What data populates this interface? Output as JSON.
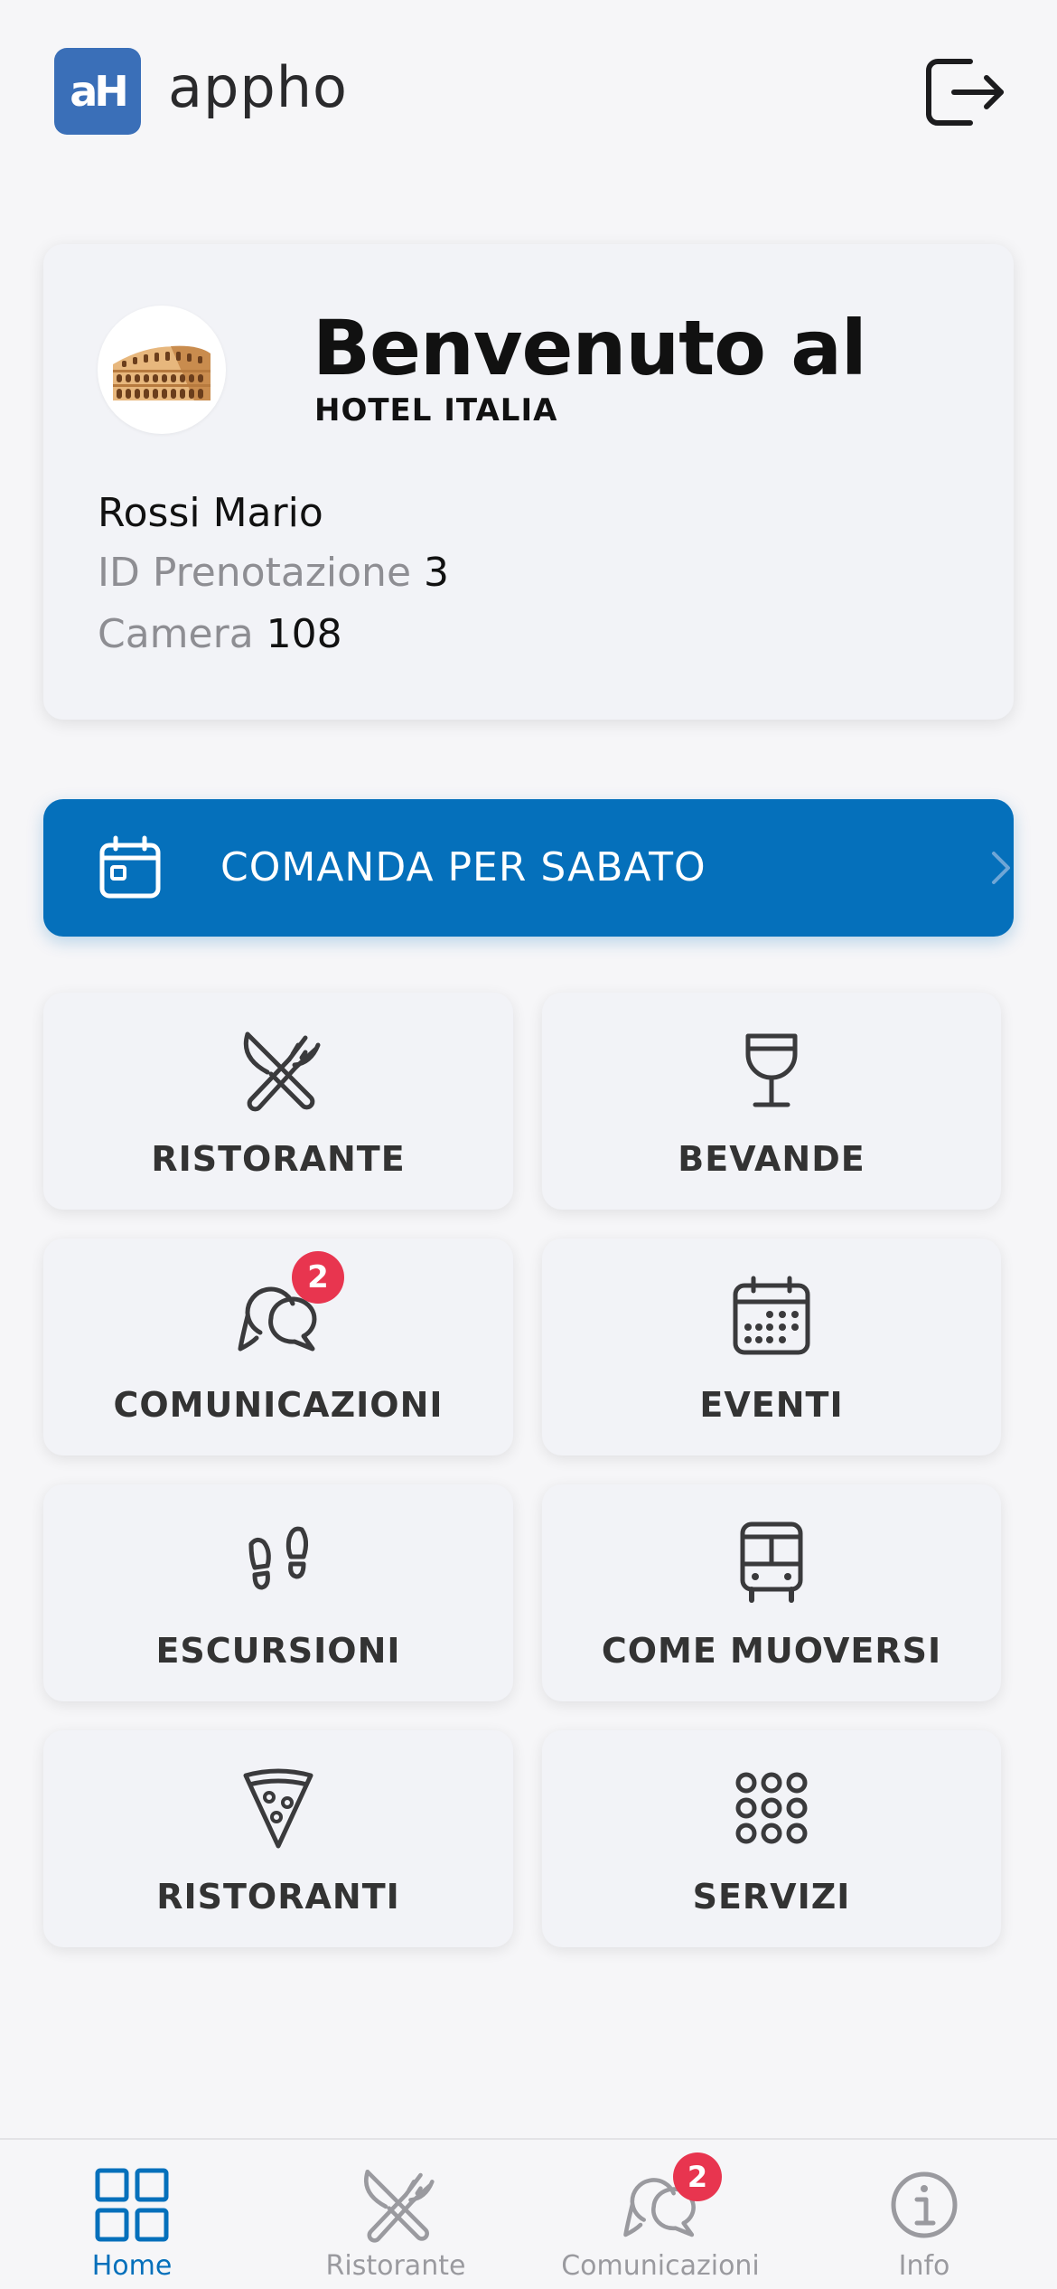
{
  "header": {
    "logo_text": "aH",
    "brand": "appho",
    "logout_icon": "logout-icon"
  },
  "welcome": {
    "title": "Benvenuto al",
    "hotel_name": "HOTEL ITALIA",
    "guest_name": "Rossi Mario",
    "booking_label": "ID Prenotazione",
    "booking_id": "3",
    "room_label": "Camera",
    "room_number": "108",
    "avatar_icon": "colosseum-icon"
  },
  "order_banner": {
    "label": "COMANDA PER SABATO",
    "icon": "calendar-icon",
    "chevron": "chevron-right-icon",
    "color": "#0570bb"
  },
  "tiles": [
    {
      "label": "RISTORANTE",
      "icon": "fork-knife-icon"
    },
    {
      "label": "BEVANDE",
      "icon": "wine-glass-icon"
    },
    {
      "label": "COMUNICAZIONI",
      "icon": "chat-bubbles-icon",
      "badge": "2"
    },
    {
      "label": "EVENTI",
      "icon": "calendar-grid-icon"
    },
    {
      "label": "ESCURSIONI",
      "icon": "footprints-icon"
    },
    {
      "label": "COME MUOVERSI",
      "icon": "bus-icon"
    },
    {
      "label": "RISTORANTI",
      "icon": "pizza-slice-icon"
    },
    {
      "label": "SERVIZI",
      "icon": "apps-grid-icon"
    }
  ],
  "bottom_nav": [
    {
      "label": "Home",
      "icon": "home-grid-icon",
      "active": true
    },
    {
      "label": "Ristorante",
      "icon": "fork-knife-icon",
      "active": false
    },
    {
      "label": "Comunicazioni",
      "icon": "chat-bubbles-icon",
      "active": false,
      "badge": "2"
    },
    {
      "label": "Info",
      "icon": "info-icon",
      "active": false
    }
  ],
  "colors": {
    "accent": "#0570bb",
    "badge": "#e8354f",
    "logo": "#3a6fb8"
  }
}
